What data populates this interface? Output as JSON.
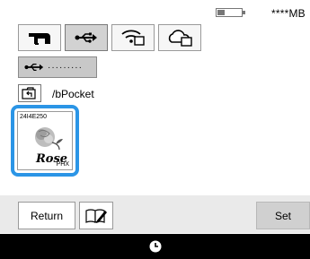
{
  "status": {
    "memory_label": "****MB",
    "battery_level": 0.3
  },
  "source_tabs": [
    {
      "name": "sewing-machine",
      "icon": "sewing-machine-icon",
      "active": false
    },
    {
      "name": "usb",
      "icon": "usb-icon",
      "active": true
    },
    {
      "name": "wifi",
      "icon": "wifi-icon",
      "active": false
    },
    {
      "name": "cloud",
      "icon": "cloud-icon",
      "active": false
    }
  ],
  "device": {
    "label": "·········",
    "icon": "usb-icon"
  },
  "path": {
    "text": "/bPocket",
    "up_icon": "folder-up-icon"
  },
  "file": {
    "name": "24I4E250",
    "extension": "PHX",
    "art_text": "Rose",
    "icon": "rose-embroidery-icon"
  },
  "bottom": {
    "return_label": "Return",
    "edit_icon": "pen-book-icon",
    "set_label": "Set"
  },
  "system": {
    "icon": "clock-icon"
  },
  "colors": {
    "selection_border": "#2b95e6",
    "active_tab": "#d2d2d2",
    "set_button": "#d0d0d0"
  }
}
